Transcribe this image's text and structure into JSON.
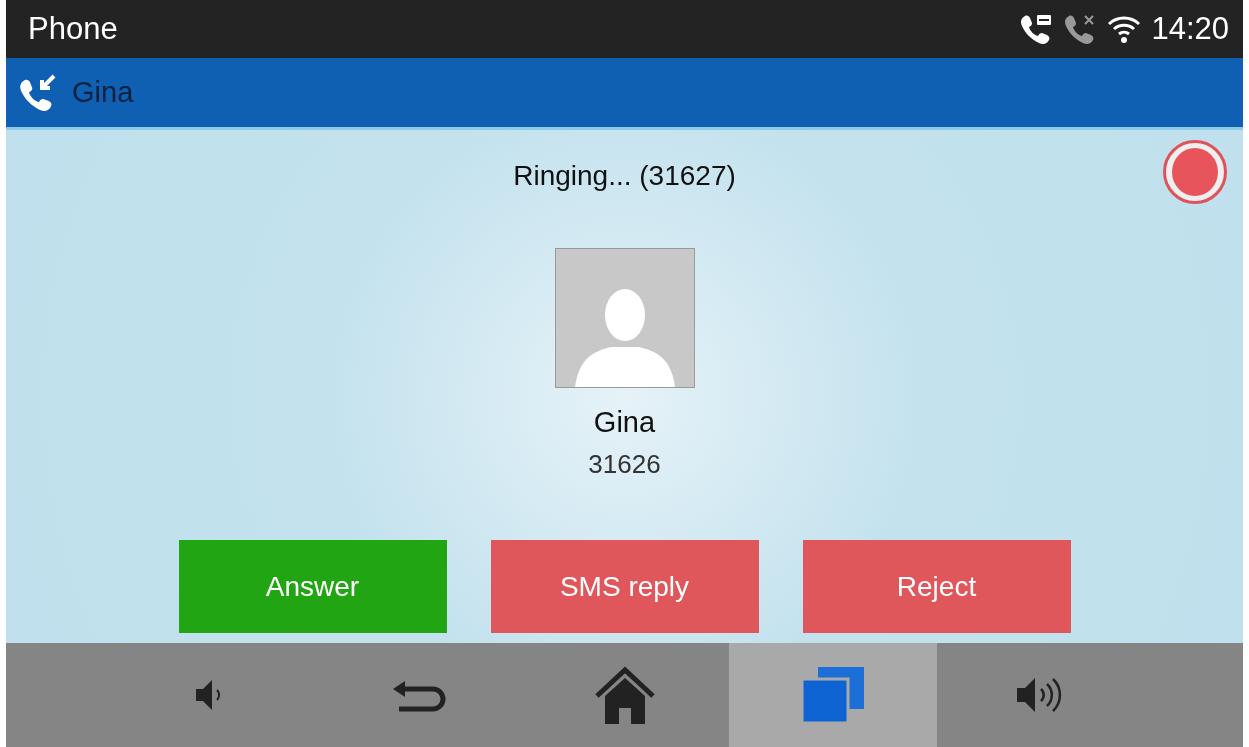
{
  "status_bar": {
    "app_title": "Phone",
    "time": "14:20"
  },
  "call_header": {
    "name": "Gina"
  },
  "call": {
    "status": "Ringing... (31627)",
    "recording": false,
    "contact_name": "Gina",
    "contact_number": "31626"
  },
  "actions": [
    {
      "label": "Answer",
      "kind": "accept"
    },
    {
      "label": "SMS reply",
      "kind": "decline"
    },
    {
      "label": "Reject",
      "kind": "decline"
    }
  ],
  "nav_bar": [
    {
      "kind": "volume-down",
      "selected": false
    },
    {
      "kind": "back",
      "selected": false
    },
    {
      "kind": "home",
      "selected": false
    },
    {
      "kind": "recents",
      "selected": true
    },
    {
      "kind": "volume-up",
      "selected": false
    }
  ]
}
